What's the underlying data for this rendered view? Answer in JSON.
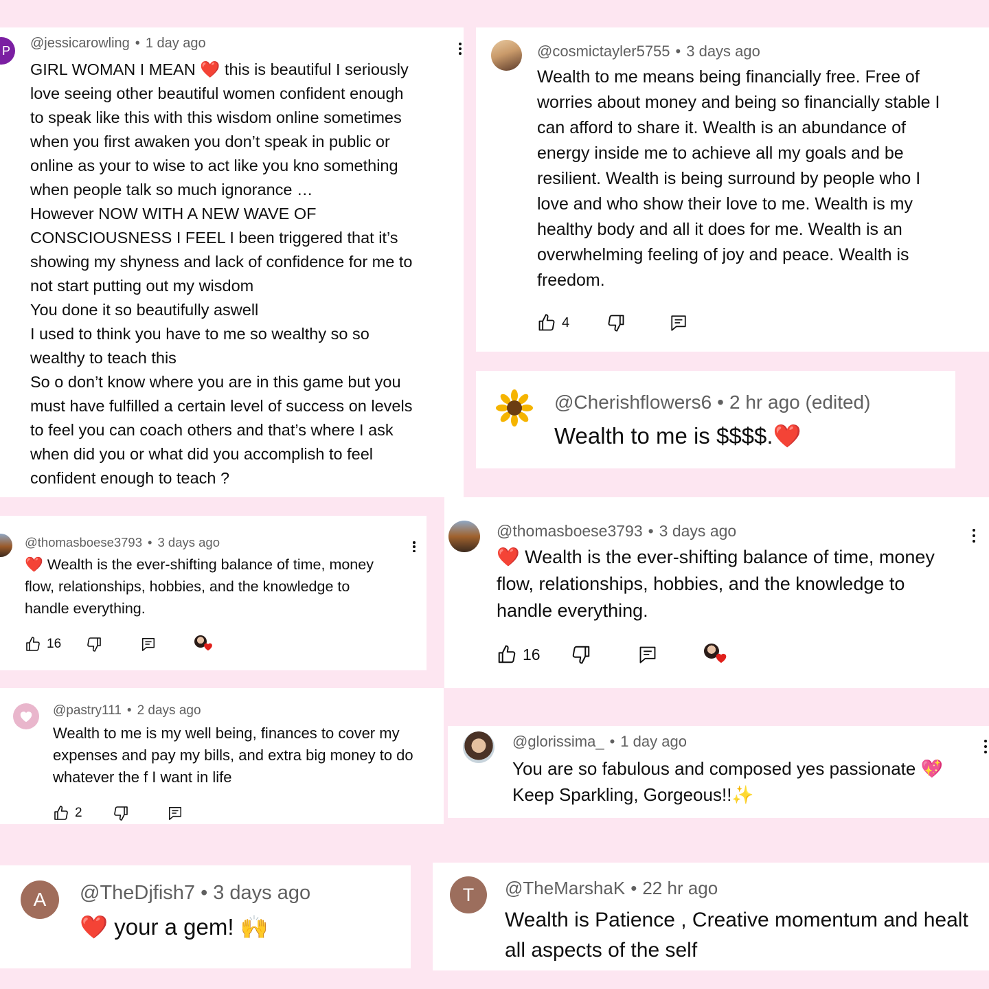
{
  "comments": {
    "c1": {
      "handle": "@jessicarowling",
      "time": "1 day ago",
      "lines": [
        "GIRL WOMAN I MEAN ❤️ this is beautiful I seriously",
        "love seeing other beautiful women confident enough",
        "to speak like this with this wisdom online sometimes",
        "when you first awaken you don’t speak in public or",
        "online as your to wise to act like you kno something",
        "when people talk so much ignorance …",
        "However NOW WITH A NEW WAVE OF",
        "CONSCIOUSNESS I FEEL I been triggered that it’s",
        "showing my shyness and lack of confidence for me to",
        "not start putting out my wisdom",
        "You done it so beautifully aswell",
        "I used to think you have to me so wealthy so so",
        "wealthy to teach this",
        "So o don’t know where you are in this game but you",
        "must have fulfilled a certain level of success on levels",
        "to feel you can coach others and that’s where I ask",
        "when did you or what did you accomplish to feel",
        "confident enough to teach ?"
      ],
      "avatar_letter": "P"
    },
    "c2": {
      "handle": "@cosmictayler5755",
      "time": "3 days ago",
      "lines": [
        "Wealth to me means being financially free. Free of",
        "worries about money and being so financially stable I",
        "can afford to share it. Wealth is an abundance of",
        "energy inside me to achieve all my goals and be",
        "resilient. Wealth is being surround by people who I",
        "love and who show their love to me. Wealth is my",
        "healthy body and all it does for me. Wealth is an",
        "overwhelming feeling of joy and peace. Wealth is",
        "freedom."
      ],
      "likes": "4"
    },
    "c3": {
      "handle": "@Cherishflowers6",
      "time": "2 hr ago (edited)",
      "text": "Wealth to me is $$$$.❤️"
    },
    "c4": {
      "handle": "@thomasboese3793",
      "time": "3 days ago",
      "lines": [
        "❤️ Wealth is the ever-shifting balance of time, money",
        "flow, relationships, hobbies, and the knowledge to",
        "handle everything."
      ],
      "likes": "16"
    },
    "c5": {
      "handle": "@thomasboese3793",
      "time": "3 days ago",
      "lines": [
        "❤️ Wealth is the ever-shifting balance of time, money",
        "flow, relationships, hobbies, and the knowledge to",
        "handle everything."
      ],
      "likes": "16"
    },
    "c6": {
      "handle": "@pastry111",
      "time": "2 days ago",
      "lines": [
        "Wealth to me is my well being, finances to cover my",
        "expenses and pay my bills, and extra big money to do",
        "whatever the f I want in life"
      ],
      "likes": "2"
    },
    "c7": {
      "handle": "@glorissima_",
      "time": "1 day ago",
      "lines": [
        "You are so fabulous and composed yes passionate 💖",
        "Keep Sparkling, Gorgeous!!✨"
      ]
    },
    "c8": {
      "handle": "@TheDjfish7",
      "time": "3 days ago",
      "text": "❤️  your a gem! 🙌",
      "avatar_letter": "A"
    },
    "c9": {
      "handle": "@TheMarshaK",
      "time": "22 hr ago",
      "lines": [
        "Wealth is Patience , Creative momentum and healt",
        "all aspects of the self"
      ],
      "avatar_letter": "T"
    }
  },
  "icons": {
    "like": "thumbs-up-icon",
    "dislike": "thumbs-down-icon",
    "reply": "reply-comment-icon",
    "more": "more-vert-icon",
    "creator_heart": "creator-heart-icon"
  },
  "colors": {
    "background": "#fde6f1",
    "card": "#ffffff",
    "meta_text": "#606060",
    "heart": "#e0201b",
    "avatar_a": "#a06d5b",
    "avatar_t": "#9c6e5d",
    "avatar_p": "#7b1fa2"
  }
}
